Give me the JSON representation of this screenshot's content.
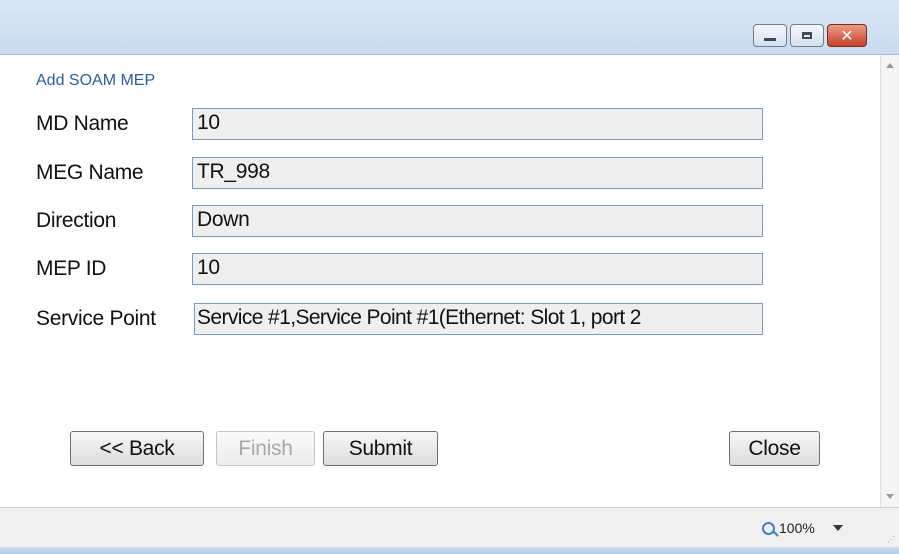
{
  "window": {
    "controls": {
      "minimize_icon": "minimize-icon",
      "maximize_icon": "maximize-icon",
      "close_glyph": "✕"
    }
  },
  "dialog": {
    "heading": "Add SOAM MEP",
    "fields": [
      {
        "label": "MD Name",
        "value": "10"
      },
      {
        "label": "MEG Name",
        "value": "TR_998"
      },
      {
        "label": "Direction",
        "value": "Down"
      },
      {
        "label": "MEP ID",
        "value": "10"
      },
      {
        "label": "Service Point",
        "value": "Service #1,Service Point #1(Ethernet: Slot 1, port 2"
      }
    ],
    "buttons": {
      "back": "<< Back",
      "finish": "Finish",
      "submit": "Submit",
      "close": "Close"
    }
  },
  "statusbar": {
    "zoom": "100%"
  },
  "colors": {
    "heading": "#2a5d9b",
    "field_border": "#7a9cc4",
    "field_bg": "#efefef",
    "titlebar": "#c9dbee",
    "close_button": "#c7412a"
  }
}
